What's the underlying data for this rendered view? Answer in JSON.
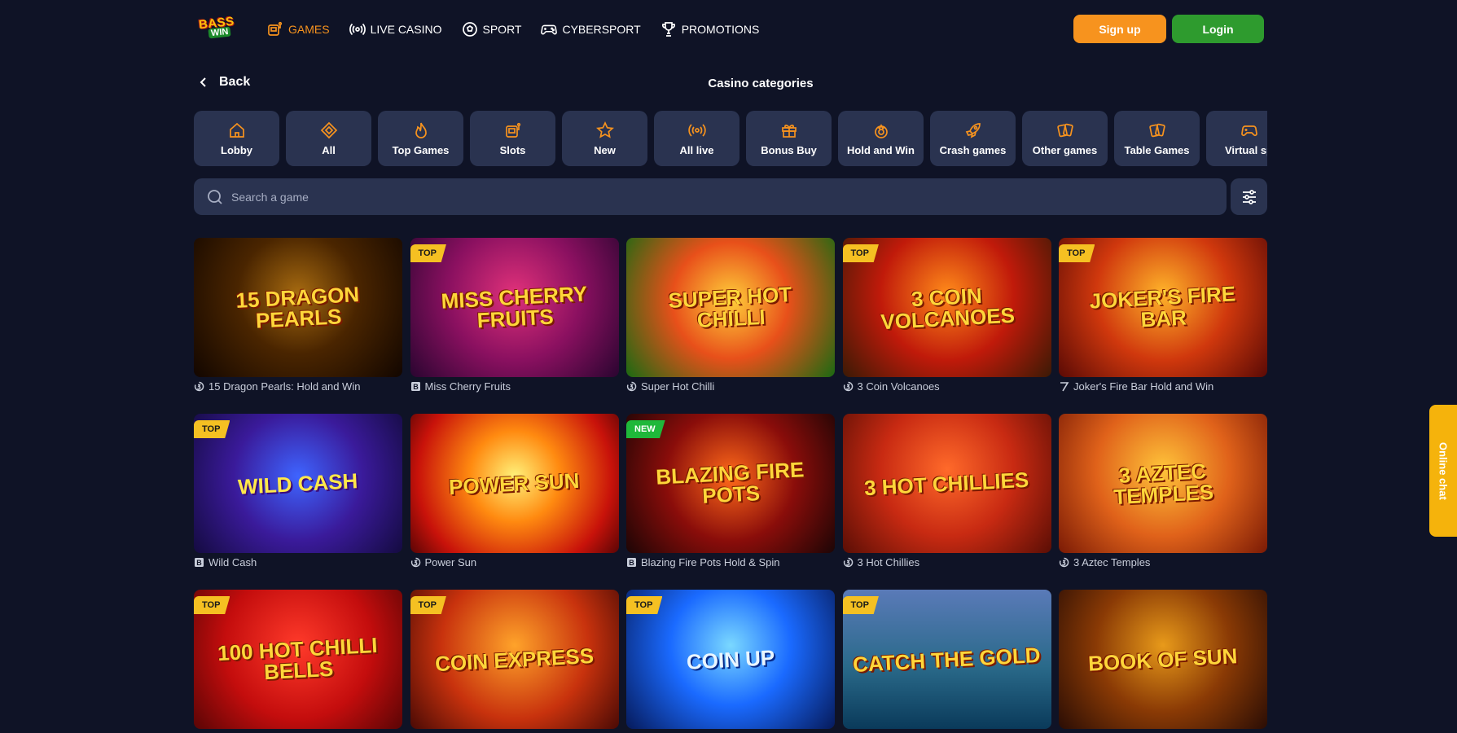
{
  "header": {
    "logo_top": "BASS",
    "logo_bottom": "WIN",
    "nav": [
      {
        "label": "GAMES",
        "icon": "slot-machine-icon"
      },
      {
        "label": "LIVE CASINO",
        "icon": "live-broadcast-icon"
      },
      {
        "label": "SPORT",
        "icon": "soccer-ball-icon"
      },
      {
        "label": "CYBERSPORT",
        "icon": "gamepad-icon"
      },
      {
        "label": "PROMOTIONS",
        "icon": "trophy-icon"
      }
    ],
    "signup_label": "Sign up",
    "login_label": "Login"
  },
  "back_label": "Back",
  "page_title": "Casino categories",
  "categories": [
    {
      "label": "Lobby",
      "icon": "home-icon"
    },
    {
      "label": "All",
      "icon": "diamond-icon"
    },
    {
      "label": "Top Games",
      "icon": "flame-icon"
    },
    {
      "label": "Slots",
      "icon": "slot-machine-icon"
    },
    {
      "label": "New",
      "icon": "star-icon"
    },
    {
      "label": "All live",
      "icon": "live-broadcast-icon"
    },
    {
      "label": "Bonus Buy",
      "icon": "gift-icon"
    },
    {
      "label": "Hold and Win",
      "icon": "crown-chip-icon"
    },
    {
      "label": "Crash games",
      "icon": "rocket-icon"
    },
    {
      "label": "Other games",
      "icon": "cards-icon"
    },
    {
      "label": "Table Games",
      "icon": "cards-icon"
    },
    {
      "label": "Virtual sp",
      "icon": "gamepad-icon"
    }
  ],
  "search": {
    "placeholder": "Search a game"
  },
  "games": [
    {
      "name": "15 Dragon Pearls: Hold and Win",
      "thumb_title": "15 Dragon Pearls",
      "badge": "",
      "provider_icon": "provider-3oaks-icon"
    },
    {
      "name": "Miss Cherry Fruits",
      "thumb_title": "Miss Cherry Fruits",
      "badge": "TOP",
      "provider_icon": "provider-bgaming-icon"
    },
    {
      "name": "Super Hot Chilli",
      "thumb_title": "Super Hot Chilli",
      "badge": "",
      "provider_icon": "provider-3oaks-icon"
    },
    {
      "name": "3 Coin Volcanoes",
      "thumb_title": "3 Coin Volcanoes",
      "badge": "TOP",
      "provider_icon": "provider-3oaks-icon"
    },
    {
      "name": "Joker's Fire Bar Hold and Win",
      "thumb_title": "Joker's Fire Bar",
      "badge": "TOP",
      "provider_icon": "provider-7-icon"
    },
    {
      "name": "Wild Cash",
      "thumb_title": "Wild Cash",
      "badge": "TOP",
      "provider_icon": "provider-bgaming-icon"
    },
    {
      "name": "Power Sun",
      "thumb_title": "Power Sun",
      "badge": "",
      "provider_icon": "provider-3oaks-icon"
    },
    {
      "name": "Blazing Fire Pots Hold & Spin",
      "thumb_title": "Blazing Fire Pots",
      "badge": "NEW",
      "provider_icon": "provider-bgaming-icon"
    },
    {
      "name": "3 Hot Chillies",
      "thumb_title": "3 Hot Chillies",
      "badge": "",
      "provider_icon": "provider-3oaks-icon"
    },
    {
      "name": "3 Aztec Temples",
      "thumb_title": "3 Aztec Temples",
      "badge": "",
      "provider_icon": "provider-3oaks-icon"
    },
    {
      "name": "",
      "thumb_title": "100 Hot Chilli Bells",
      "badge": "TOP",
      "provider_icon": ""
    },
    {
      "name": "",
      "thumb_title": "Coin Express",
      "badge": "TOP",
      "provider_icon": ""
    },
    {
      "name": "",
      "thumb_title": "Coin Up",
      "badge": "TOP",
      "provider_icon": ""
    },
    {
      "name": "",
      "thumb_title": "Catch the Gold",
      "badge": "TOP",
      "provider_icon": ""
    },
    {
      "name": "",
      "thumb_title": "Book of Sun",
      "badge": "",
      "provider_icon": ""
    }
  ],
  "chat_label": "Online chat",
  "colors": {
    "background": "#0f1326",
    "accent": "#f7931e",
    "login": "#2e9b2e",
    "card": "#2a3350",
    "chat": "#f5b30c"
  }
}
